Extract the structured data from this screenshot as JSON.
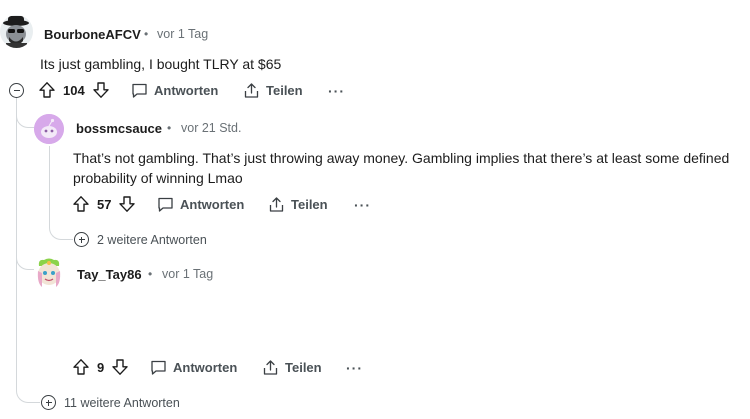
{
  "comments": [
    {
      "username": "BourboneAFCV",
      "separator": "•",
      "timestamp": "vor 1 Tag",
      "text": "Its just gambling, I bought TLRY at $65",
      "votes": "104",
      "reply_label": "Antworten",
      "share_label": "Teilen",
      "more_label": "···"
    },
    {
      "username": "bossmcsauce",
      "separator": "•",
      "timestamp": "vor 21 Std.",
      "text": "That’s not gambling. That’s just throwing away money. Gambling implies that there’s at least some defined probability of winning Lmao",
      "votes": "57",
      "reply_label": "Antworten",
      "share_label": "Teilen",
      "more_label": "···",
      "more_replies": "2 weitere Antworten"
    },
    {
      "username": "Tay_Tay86",
      "separator": "•",
      "timestamp": "vor 1 Tag",
      "text": "",
      "votes": "9",
      "reply_label": "Antworten",
      "share_label": "Teilen",
      "more_label": "···"
    }
  ],
  "thread_more_replies": "11 weitere Antworten",
  "icons": {
    "upvote": "upvote-icon",
    "downvote": "downvote-icon",
    "reply": "comment-bubble-icon",
    "share": "share-icon",
    "collapse": "collapse-minus-icon",
    "expand": "expand-plus-icon"
  },
  "colors": {
    "text": "#1c1c1c",
    "meta": "#6a7176",
    "thread_line": "#d4d8db",
    "avatar2_bg": "#d7a9ea"
  }
}
